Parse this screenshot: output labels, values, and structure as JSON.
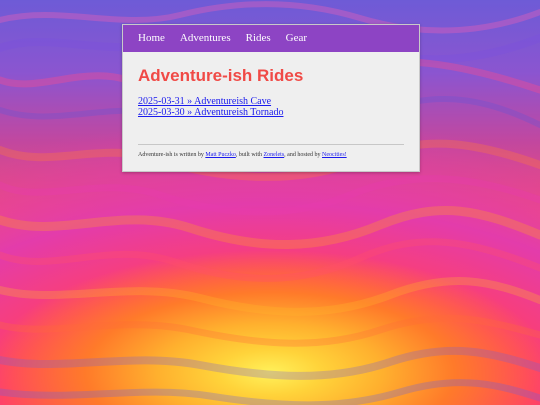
{
  "nav": {
    "items": [
      {
        "label": "Home"
      },
      {
        "label": "Adventures"
      },
      {
        "label": "Rides"
      },
      {
        "label": "Gear"
      }
    ]
  },
  "main": {
    "title": "Adventure-ish Rides",
    "posts": [
      {
        "label": "2025-03-31 » Adventureish Cave"
      },
      {
        "label": "2025-03-30 » Adventureish Tornado"
      }
    ]
  },
  "footer": {
    "text_1": "Adventure-ish is written by ",
    "author_link": "Matt Puczko",
    "text_2": ", built with ",
    "tool_link": "Zonelets",
    "text_3": ", and hosted by ",
    "host_link": "Neocities!"
  },
  "colors": {
    "nav_bg": "#8d44c4",
    "title": "#f04a46",
    "link": "#1a1aee"
  }
}
